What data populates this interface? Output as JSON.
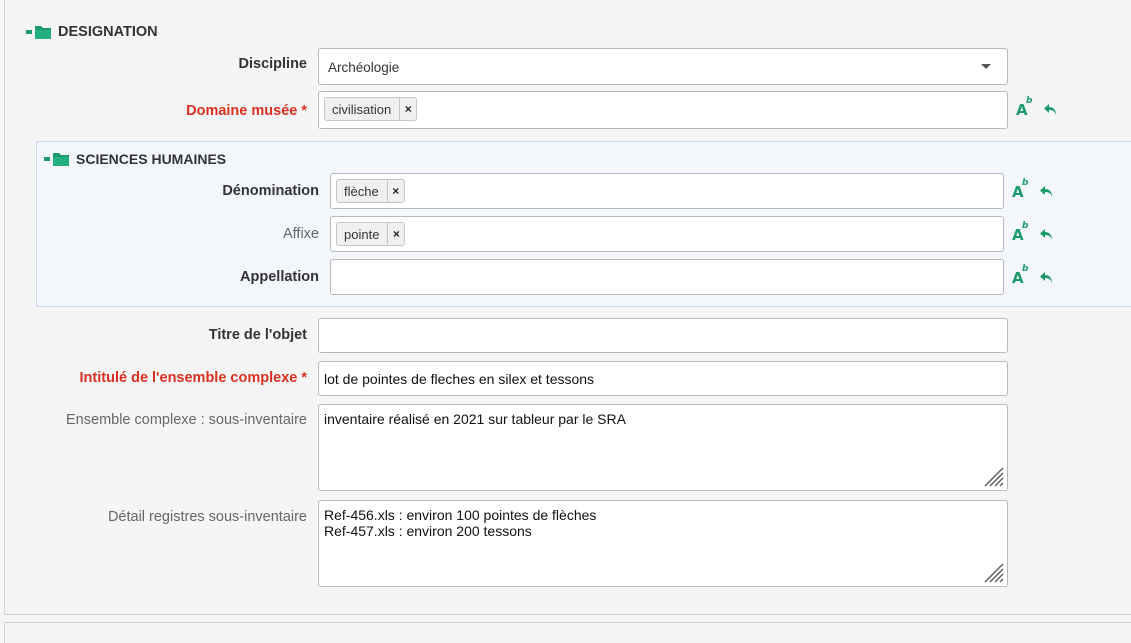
{
  "sections": {
    "designation": {
      "title": "DESIGNATION"
    },
    "sciences_humaines": {
      "title": "SCIENCES HUMAINES"
    }
  },
  "fields": {
    "discipline": {
      "label": "Discipline",
      "value": "Archéologie"
    },
    "domaine_musee": {
      "label": "Domaine musée *",
      "tags": [
        "civilisation"
      ]
    },
    "denomination": {
      "label": "Dénomination",
      "tags": [
        "flèche"
      ]
    },
    "affixe": {
      "label": "Affixe",
      "tags": [
        "pointe"
      ]
    },
    "appellation": {
      "label": "Appellation",
      "value": ""
    },
    "titre_objet": {
      "label": "Titre de l'objet",
      "value": ""
    },
    "intitule_ensemble": {
      "label": "Intitulé de l'ensemble complexe *",
      "value": "lot de pointes de fleches en silex et tessons"
    },
    "ensemble_sous_inventaire": {
      "label": "Ensemble complexe : sous-inventaire",
      "value": "inventaire réalisé en 2021 sur tableur par le SRA"
    },
    "detail_registres": {
      "label": "Détail registres sous-inventaire",
      "value": "Ref-456.xls : environ 100 pointes de flèches\nRef-457.xls : environ 200 tessons"
    }
  },
  "tag_remove": "×",
  "actions": {
    "format_icon": "A",
    "format_sup": "b"
  },
  "icons": {
    "section": "folder-open-icon",
    "format": "text-format-icon",
    "undo": "undo-icon"
  },
  "colors": {
    "accent": "#1d9a6c",
    "required": "#d9301f"
  }
}
